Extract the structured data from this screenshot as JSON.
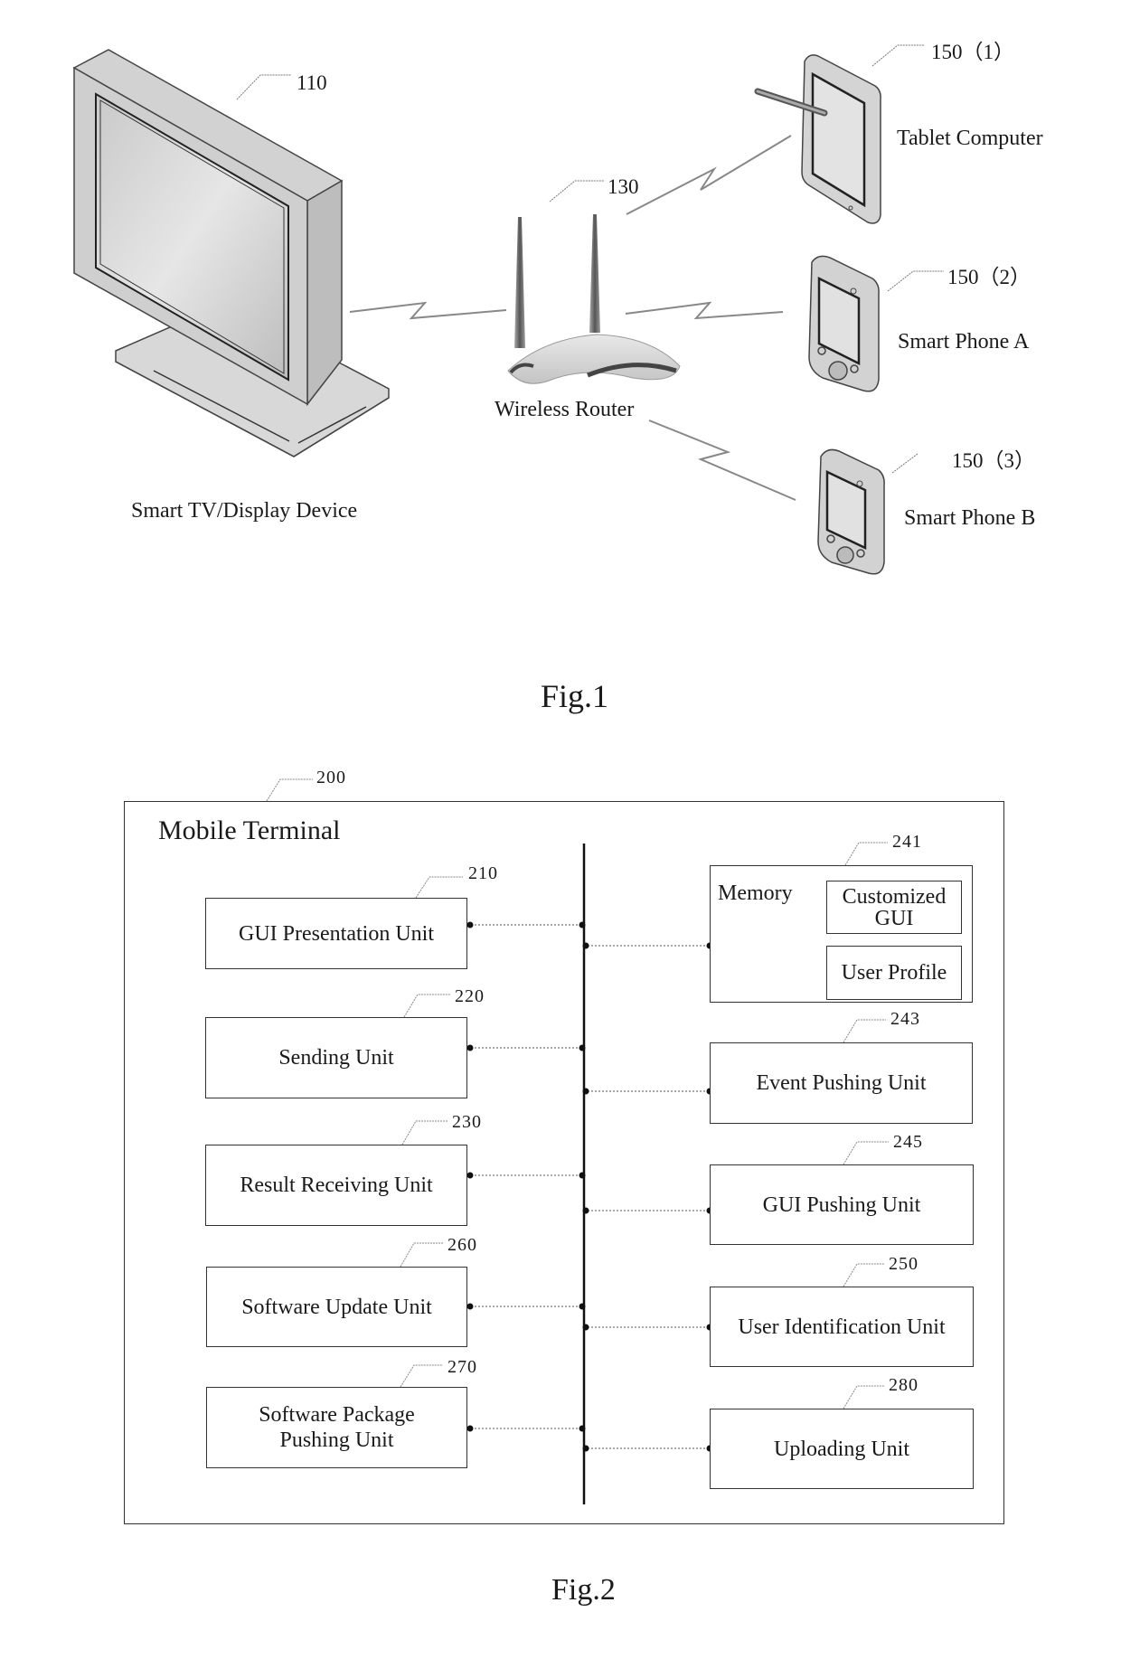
{
  "fig1": {
    "caption": "Fig.1",
    "tv": {
      "ref": "110",
      "label": "Smart TV/Display Device"
    },
    "router": {
      "ref": "130",
      "label": "Wireless Router"
    },
    "tablet": {
      "ref": "150（1）",
      "label": "Tablet Computer"
    },
    "phone_a": {
      "ref": "150（2）",
      "label": "Smart Phone A"
    },
    "phone_b": {
      "ref": "150（3）",
      "label": "Smart Phone B"
    }
  },
  "fig2": {
    "caption": "Fig.2",
    "container": {
      "ref": "200",
      "title": "Mobile Terminal"
    },
    "left_units": [
      {
        "ref": "210",
        "label": "GUI Presentation Unit"
      },
      {
        "ref": "220",
        "label": "Sending Unit"
      },
      {
        "ref": "230",
        "label": "Result Receiving Unit"
      },
      {
        "ref": "260",
        "label": "Software Update Unit"
      },
      {
        "ref": "270",
        "label": "Software Package Pushing Unit",
        "line1": "Software Package",
        "line2": "Pushing Unit"
      }
    ],
    "memory": {
      "ref": "241",
      "label": "Memory",
      "items": [
        {
          "label": "Customized GUI",
          "line1": "Customized",
          "line2": "GUI"
        },
        {
          "label": "User Profile"
        }
      ]
    },
    "right_units": [
      {
        "ref": "243",
        "label": "Event Pushing Unit"
      },
      {
        "ref": "245",
        "label": "GUI Pushing Unit"
      },
      {
        "ref": "250",
        "label": "User Identification Unit"
      },
      {
        "ref": "280",
        "label": "Uploading Unit"
      }
    ]
  }
}
